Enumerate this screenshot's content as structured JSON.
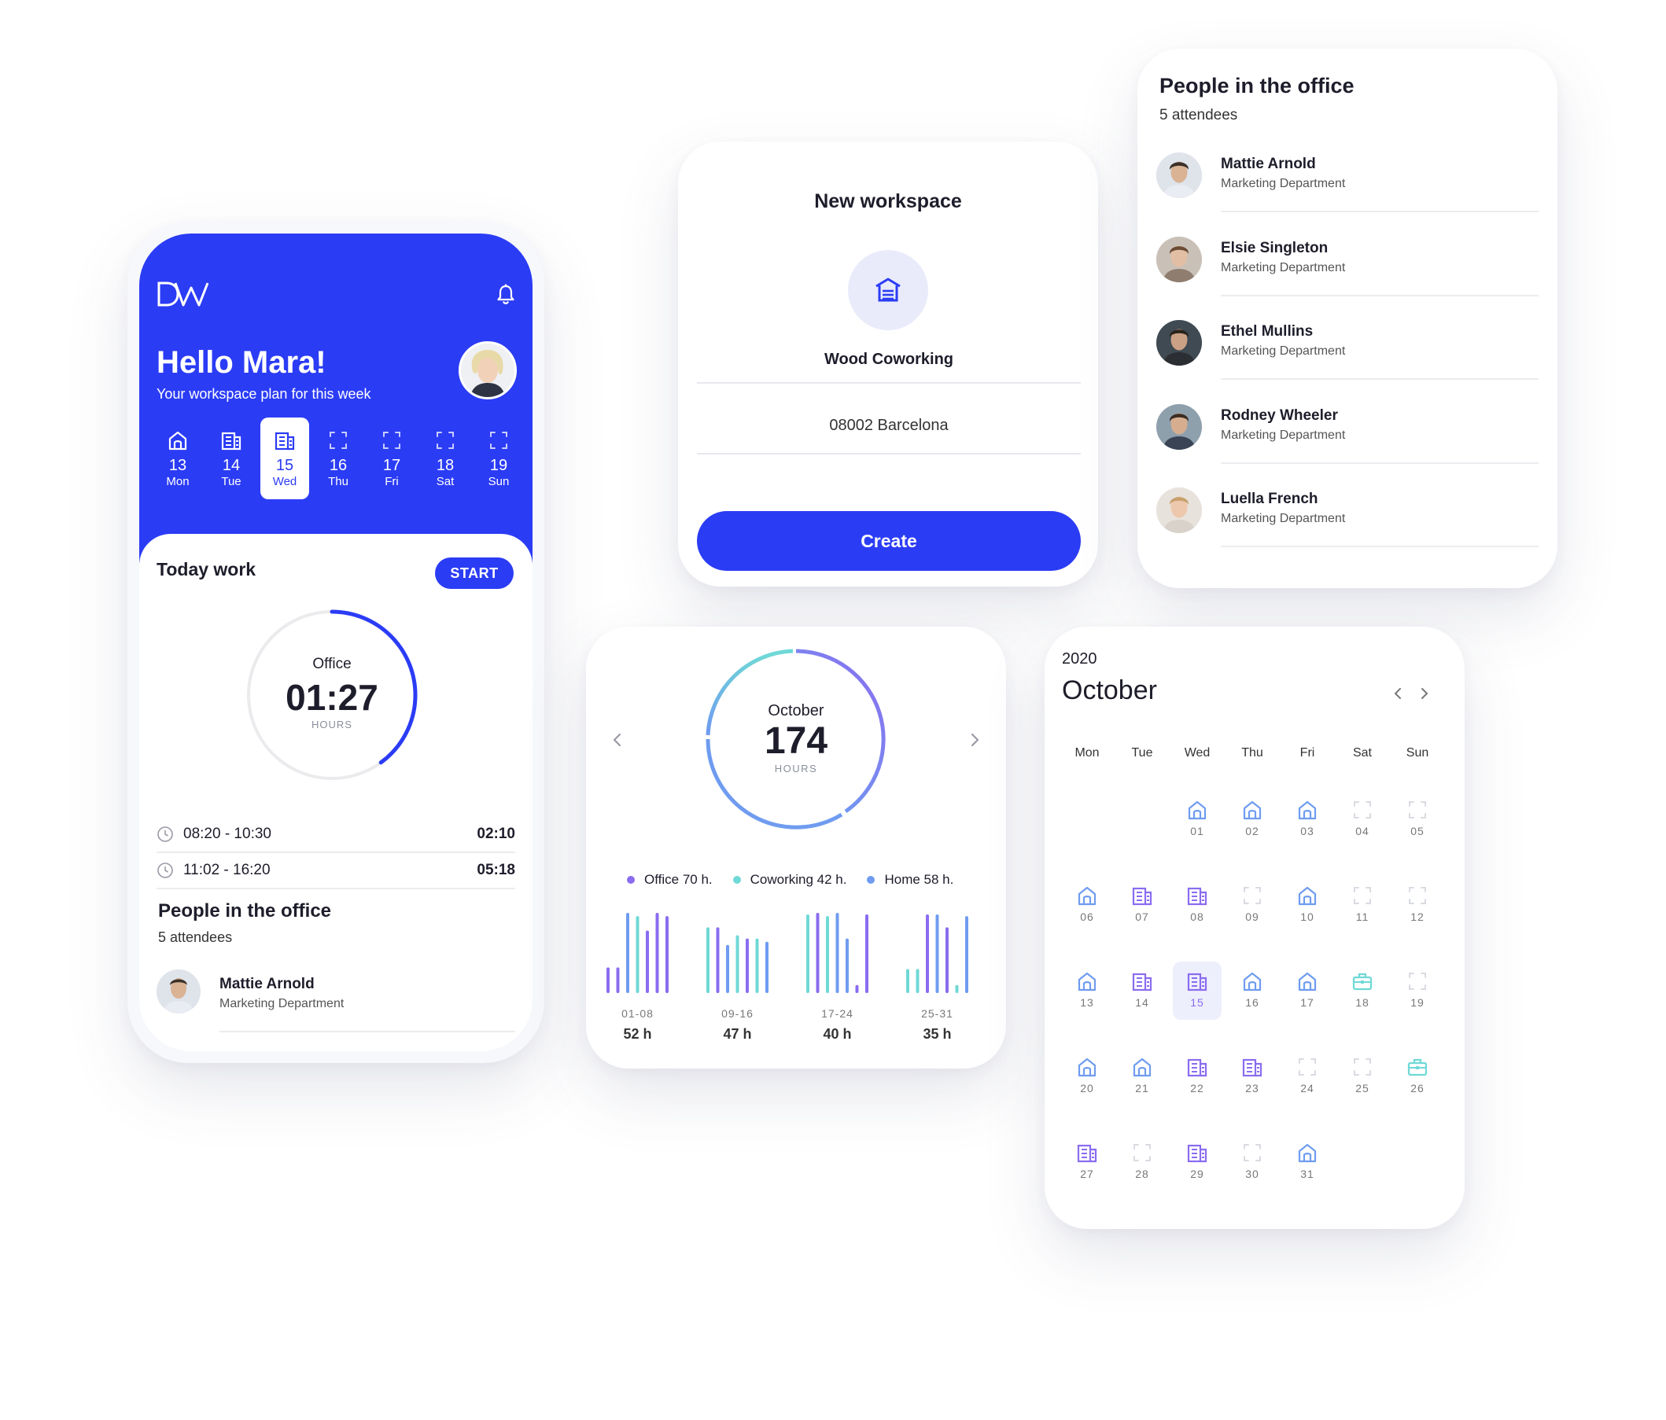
{
  "phone": {
    "brand": "DW",
    "greeting": "Hello Mara!",
    "subtitle": "Your workspace plan for this week",
    "week": [
      {
        "num": "13",
        "day": "Mon",
        "icon": "home-icon",
        "active": false
      },
      {
        "num": "14",
        "day": "Tue",
        "icon": "office-icon",
        "active": false
      },
      {
        "num": "15",
        "day": "Wed",
        "icon": "office-icon",
        "active": true
      },
      {
        "num": "16",
        "day": "Thu",
        "icon": "empty-slot-icon",
        "active": false
      },
      {
        "num": "17",
        "day": "Fri",
        "icon": "empty-slot-icon",
        "active": false
      },
      {
        "num": "18",
        "day": "Sat",
        "icon": "empty-slot-icon",
        "active": false
      },
      {
        "num": "19",
        "day": "Sun",
        "icon": "empty-slot-icon",
        "active": false
      }
    ],
    "today_work": {
      "title": "Today work",
      "start_label": "START",
      "location": "Office",
      "time": "01:27",
      "unit": "HOURS",
      "progress": 0.4,
      "sessions": [
        {
          "range": "08:20 - 10:30",
          "duration": "02:10"
        },
        {
          "range": "11:02 - 16:20",
          "duration": "05:18"
        }
      ]
    },
    "people": {
      "title": "People in the office",
      "count": "5 attendees",
      "first": {
        "name": "Mattie Arnold",
        "department": "Marketing Department"
      }
    }
  },
  "new_workspace": {
    "title": "New workspace",
    "name": "Wood Coworking",
    "address": "08002 Barcelona",
    "create_label": "Create"
  },
  "people_card": {
    "title": "People in the office",
    "count": "5 attendees",
    "list": [
      {
        "name": "Mattie Arnold",
        "department": "Marketing Department"
      },
      {
        "name": "Elsie Singleton",
        "department": "Marketing Department"
      },
      {
        "name": "Ethel Mullins",
        "department": "Marketing Department"
      },
      {
        "name": "Rodney Wheeler",
        "department": "Marketing Department"
      },
      {
        "name": "Luella French",
        "department": "Marketing Department"
      }
    ]
  },
  "stats": {
    "month": "October",
    "total": "174",
    "unit": "HOURS",
    "legend": [
      {
        "label": "Office 70 h.",
        "color": "#8a6cf0"
      },
      {
        "label": "Coworking 42 h.",
        "color": "#6fd9d6"
      },
      {
        "label": "Home 58 h.",
        "color": "#6f9cf0"
      }
    ]
  },
  "chart_data": {
    "type": "bar",
    "series_colors": {
      "office": "#8a6cf0",
      "coworking": "#6fd9d6",
      "home": "#6f9cf0"
    },
    "breakdown": [
      {
        "name": "Office",
        "value": 70
      },
      {
        "name": "Coworking",
        "value": 42
      },
      {
        "name": "Home",
        "value": 58
      }
    ],
    "weeks": [
      {
        "label": "01-08",
        "hours": "52 h",
        "bars": [
          {
            "v": 0.32,
            "c": "office"
          },
          {
            "v": 0.32,
            "c": "office"
          },
          {
            "v": 1,
            "c": "home"
          },
          {
            "v": 0.96,
            "c": "coworking"
          },
          {
            "v": 0.78,
            "c": "office"
          },
          {
            "v": 1,
            "c": "office"
          },
          {
            "v": 0.96,
            "c": "office"
          }
        ]
      },
      {
        "label": "09-16",
        "hours": "47 h",
        "bars": [
          {
            "v": 0.82,
            "c": "coworking"
          },
          {
            "v": 0.82,
            "c": "office"
          },
          {
            "v": 0.6,
            "c": "home"
          },
          {
            "v": 0.72,
            "c": "coworking"
          },
          {
            "v": 0.68,
            "c": "office"
          },
          {
            "v": 0.68,
            "c": "coworking"
          },
          {
            "v": 0.64,
            "c": "home"
          }
        ]
      },
      {
        "label": "17-24",
        "hours": "40 h",
        "bars": [
          {
            "v": 0.98,
            "c": "coworking"
          },
          {
            "v": 1,
            "c": "office"
          },
          {
            "v": 0.96,
            "c": "coworking"
          },
          {
            "v": 1,
            "c": "home"
          },
          {
            "v": 0.68,
            "c": "home"
          },
          {
            "v": 0.1,
            "c": "office"
          },
          {
            "v": 0.98,
            "c": "office"
          }
        ]
      },
      {
        "label": "25-31",
        "hours": "35 h",
        "bars": [
          {
            "v": 0.3,
            "c": "coworking"
          },
          {
            "v": 0.3,
            "c": "coworking"
          },
          {
            "v": 0.98,
            "c": "office"
          },
          {
            "v": 0.98,
            "c": "home"
          },
          {
            "v": 0.82,
            "c": "office"
          },
          {
            "v": 0.1,
            "c": "coworking"
          },
          {
            "v": 0.96,
            "c": "home"
          }
        ]
      }
    ]
  },
  "calendar": {
    "year": "2020",
    "month": "October",
    "weekdays": [
      "Mon",
      "Tue",
      "Wed",
      "Thu",
      "Fri",
      "Sat",
      "Sun"
    ],
    "first_col": 2,
    "selected": "15",
    "days": [
      {
        "n": "01",
        "t": "home"
      },
      {
        "n": "02",
        "t": "home"
      },
      {
        "n": "03",
        "t": "home"
      },
      {
        "n": "04",
        "t": "empty"
      },
      {
        "n": "05",
        "t": "empty"
      },
      {
        "n": "06",
        "t": "home"
      },
      {
        "n": "07",
        "t": "office"
      },
      {
        "n": "08",
        "t": "office"
      },
      {
        "n": "09",
        "t": "empty"
      },
      {
        "n": "10",
        "t": "home"
      },
      {
        "n": "11",
        "t": "empty"
      },
      {
        "n": "12",
        "t": "empty"
      },
      {
        "n": "13",
        "t": "home"
      },
      {
        "n": "14",
        "t": "office"
      },
      {
        "n": "15",
        "t": "office"
      },
      {
        "n": "16",
        "t": "home"
      },
      {
        "n": "17",
        "t": "home"
      },
      {
        "n": "18",
        "t": "cowork"
      },
      {
        "n": "19",
        "t": "empty"
      },
      {
        "n": "20",
        "t": "home"
      },
      {
        "n": "21",
        "t": "home"
      },
      {
        "n": "22",
        "t": "office"
      },
      {
        "n": "23",
        "t": "office"
      },
      {
        "n": "24",
        "t": "empty"
      },
      {
        "n": "25",
        "t": "empty"
      },
      {
        "n": "26",
        "t": "cowork"
      },
      {
        "n": "27",
        "t": "office"
      },
      {
        "n": "28",
        "t": "empty"
      },
      {
        "n": "29",
        "t": "office"
      },
      {
        "n": "30",
        "t": "empty"
      },
      {
        "n": "31",
        "t": "home"
      }
    ]
  }
}
